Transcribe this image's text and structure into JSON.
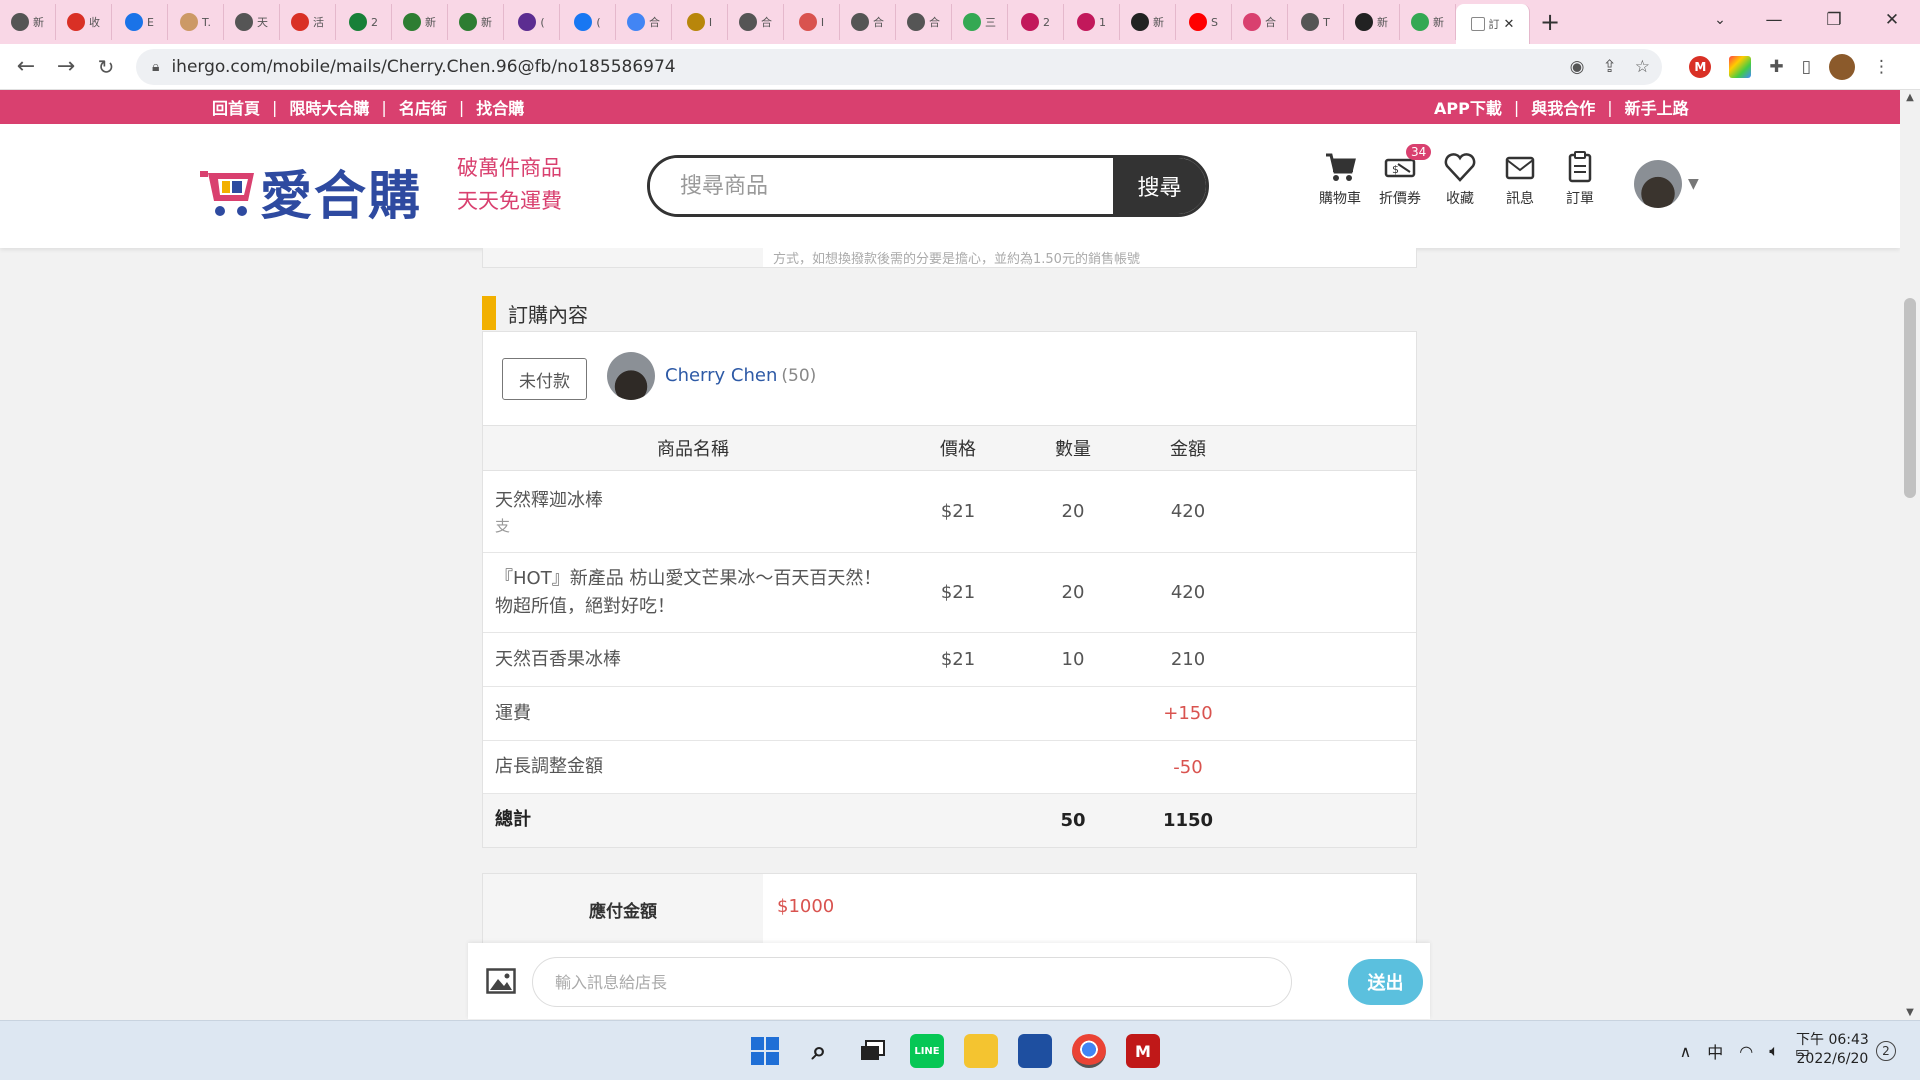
{
  "browser": {
    "tabs": [
      {
        "label": "新",
        "icon": "chrome-icon",
        "color": "#555555"
      },
      {
        "label": "收",
        "icon": "gmail-icon",
        "color": "#d93025"
      },
      {
        "label": "E",
        "icon": "globe-icon",
        "color": "#1a73e8"
      },
      {
        "label": "T.",
        "icon": "pattern-icon",
        "color": "#c96"
      },
      {
        "label": "天",
        "icon": "web-icon",
        "color": "#555555"
      },
      {
        "label": "活",
        "icon": "gmail-icon",
        "color": "#d93025"
      },
      {
        "label": "2",
        "icon": "sheets-icon",
        "color": "#188038"
      },
      {
        "label": "新",
        "icon": "play-icon",
        "color": "#2e7d32"
      },
      {
        "label": "新",
        "icon": "play-icon",
        "color": "#2e7d32"
      },
      {
        "label": "(",
        "icon": "mail-icon",
        "color": "#5c2d91"
      },
      {
        "label": "(",
        "icon": "facebook-icon",
        "color": "#1877f2"
      },
      {
        "label": "合",
        "icon": "google-icon",
        "color": "#4285f4"
      },
      {
        "label": "I",
        "icon": "image-icon",
        "color": "#b8860b"
      },
      {
        "label": "合",
        "icon": "web-icon",
        "color": "#555555"
      },
      {
        "label": "I",
        "icon": "circle-icon",
        "color": "#d9534f"
      },
      {
        "label": "合",
        "icon": "web-icon",
        "color": "#555555"
      },
      {
        "label": "合",
        "icon": "web-icon",
        "color": "#555555"
      },
      {
        "label": "三",
        "icon": "maps-icon",
        "color": "#34a853"
      },
      {
        "label": "2",
        "icon": "flower-icon",
        "color": "#c2185b"
      },
      {
        "label": "1",
        "icon": "flower-icon",
        "color": "#c2185b"
      },
      {
        "label": "新",
        "icon": "dark-icon",
        "color": "#222222"
      },
      {
        "label": "S",
        "icon": "youtube-icon",
        "color": "#ff0000"
      },
      {
        "label": "合",
        "icon": "gift-icon",
        "color": "#d9406f"
      },
      {
        "label": "T",
        "icon": "web-icon",
        "color": "#555555"
      },
      {
        "label": "新",
        "icon": "dark-icon",
        "color": "#222222"
      },
      {
        "label": "新",
        "icon": "maps-icon",
        "color": "#34a853"
      }
    ],
    "active_tab": {
      "label": "訂"
    },
    "url": "ihergo.com/mobile/mails/Cherry.Chen.96@fb/no185586974"
  },
  "topnav": {
    "left": [
      "回首頁",
      "限時大合購",
      "名店街",
      "找合購"
    ],
    "right": [
      "APP下載",
      "與我合作",
      "新手上路"
    ],
    "color": "#d9406f"
  },
  "header": {
    "brand": "愛合購",
    "slogan_line1": "破萬件商品",
    "slogan_line2": "天天免運費",
    "search_placeholder": "搜尋商品",
    "search_button": "搜尋",
    "icons": [
      {
        "name": "cart",
        "label": "購物車"
      },
      {
        "name": "coupon",
        "label": "折價券",
        "badge": "34"
      },
      {
        "name": "heart",
        "label": "收藏"
      },
      {
        "name": "message",
        "label": "訊息"
      },
      {
        "name": "order",
        "label": "訂單"
      }
    ]
  },
  "prev_card": {
    "text": "方式，如想換撥款後需的分要是擔心，並約為1.50元的銷售帳號"
  },
  "order": {
    "section_title": "訂購內容",
    "status": "未付款",
    "buyer_name": "Cherry Chen",
    "buyer_count": "(50)",
    "columns": [
      "商品名稱",
      "價格",
      "數量",
      "金額"
    ],
    "items": [
      {
        "name": "天然釋迦冰棒",
        "unit": "支",
        "price": "$21",
        "qty": "20",
        "amount": "420"
      },
      {
        "name": "『HOT』新產品 枋山愛文芒果冰～百天百天然！物超所值，絕對好吃！",
        "unit": "",
        "price": "$21",
        "qty": "20",
        "amount": "420"
      },
      {
        "name": "天然百香果冰棒",
        "unit": "",
        "price": "$21",
        "qty": "10",
        "amount": "210"
      }
    ],
    "shipping_label": "運費",
    "shipping_amount": "+150",
    "adjust_label": "店長調整金額",
    "adjust_amount": "-50",
    "total_label": "總計",
    "total_qty": "50",
    "total_amount": "1150"
  },
  "payment": {
    "label": "應付金額",
    "value": "$1000"
  },
  "message": {
    "placeholder": "輸入訊息給店長",
    "send": "送出"
  },
  "taskbar": {
    "tray_ime": "中",
    "time": "下午 06:43",
    "date": "2022/6/20",
    "notifications": "2"
  }
}
